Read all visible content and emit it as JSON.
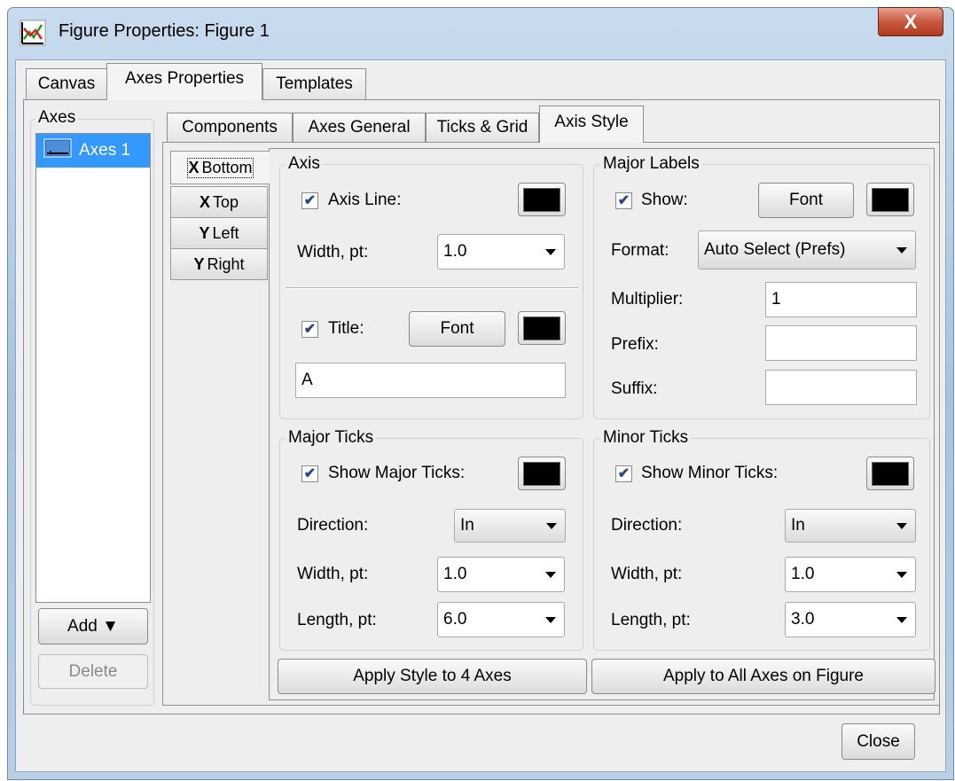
{
  "window": {
    "title": "Figure Properties: Figure 1",
    "close_glyph": "X",
    "icon": "figure-chart-icon",
    "accent_color": "#3399ff"
  },
  "main_tabs": [
    {
      "label": "Canvas"
    },
    {
      "label": "Axes Properties"
    },
    {
      "label": "Templates"
    }
  ],
  "axes_panel": {
    "title": "Axes",
    "items": [
      {
        "label": "Axes 1",
        "icon": "axes-icon"
      }
    ],
    "add_label": "Add ▼",
    "delete_label": "Delete"
  },
  "sub_tabs": [
    {
      "label": "Components"
    },
    {
      "label": "Axes General"
    },
    {
      "label": "Ticks & Grid"
    },
    {
      "label": "Axis Style"
    }
  ],
  "side_tabs": [
    {
      "axis": "X",
      "label": "Bottom"
    },
    {
      "axis": "X",
      "label": "Top"
    },
    {
      "axis": "Y",
      "label": "Left"
    },
    {
      "axis": "Y",
      "label": "Right"
    }
  ],
  "axis_group": {
    "title": "Axis",
    "axis_line_label": "Axis Line:",
    "axis_line_checked": true,
    "width_label": "Width, pt:",
    "width_value": "1.0",
    "title_label": "Title:",
    "title_checked": true,
    "font_label": "Font",
    "title_value": "A"
  },
  "major_labels": {
    "title": "Major Labels",
    "show_label": "Show:",
    "show_checked": true,
    "font_label": "Font",
    "format_label": "Format:",
    "format_value": "Auto Select (Prefs)",
    "multiplier_label": "Multiplier:",
    "multiplier_value": "1",
    "prefix_label": "Prefix:",
    "prefix_value": "",
    "suffix_label": "Suffix:",
    "suffix_value": ""
  },
  "major_ticks": {
    "title": "Major Ticks",
    "show_label": "Show Major Ticks:",
    "show_checked": true,
    "direction_label": "Direction:",
    "direction_value": "In",
    "width_label": "Width, pt:",
    "width_value": "1.0",
    "length_label": "Length, pt:",
    "length_value": "6.0"
  },
  "minor_ticks": {
    "title": "Minor Ticks",
    "show_label": "Show Minor Ticks:",
    "show_checked": true,
    "direction_label": "Direction:",
    "direction_value": "In",
    "width_label": "Width, pt:",
    "width_value": "1.0",
    "length_label": "Length, pt:",
    "length_value": "3.0"
  },
  "actions": {
    "apply_style": "Apply Style to 4 Axes",
    "apply_all": "Apply to All Axes on Figure",
    "close": "Close"
  },
  "check_glyph": "✔"
}
